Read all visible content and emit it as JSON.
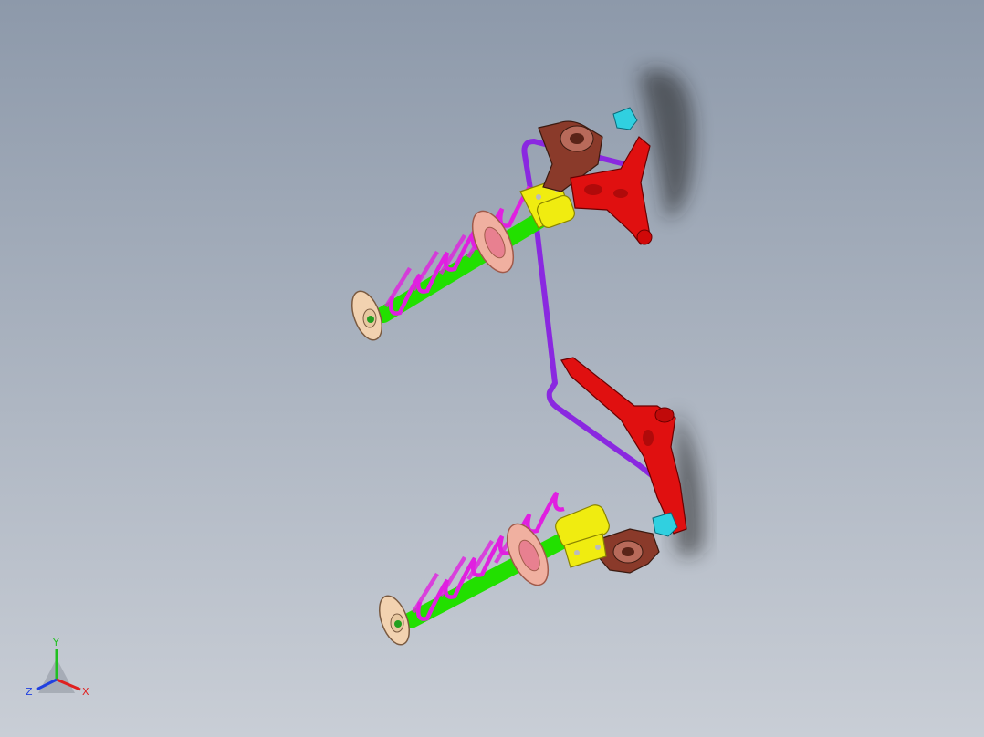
{
  "viewport": {
    "background_top": "#8d99aa",
    "background_bottom": "#c9ced6"
  },
  "colors": {
    "spring": "#e020e0",
    "strut_rod": "#22e000",
    "bracket": "#f0ec10",
    "control_arm": "#e01010",
    "knuckle": "#8a3a2a",
    "stabilizer_bar": "#8a28e0",
    "spring_seat": "#f0b0a0",
    "top_mount": "#f2d2b0",
    "ball_joint": "#30d0e0"
  },
  "triad": {
    "x_label": "X",
    "y_label": "Y",
    "z_label": "Z",
    "x_color": "#e02020",
    "y_color": "#20c020",
    "z_color": "#2040e0"
  }
}
